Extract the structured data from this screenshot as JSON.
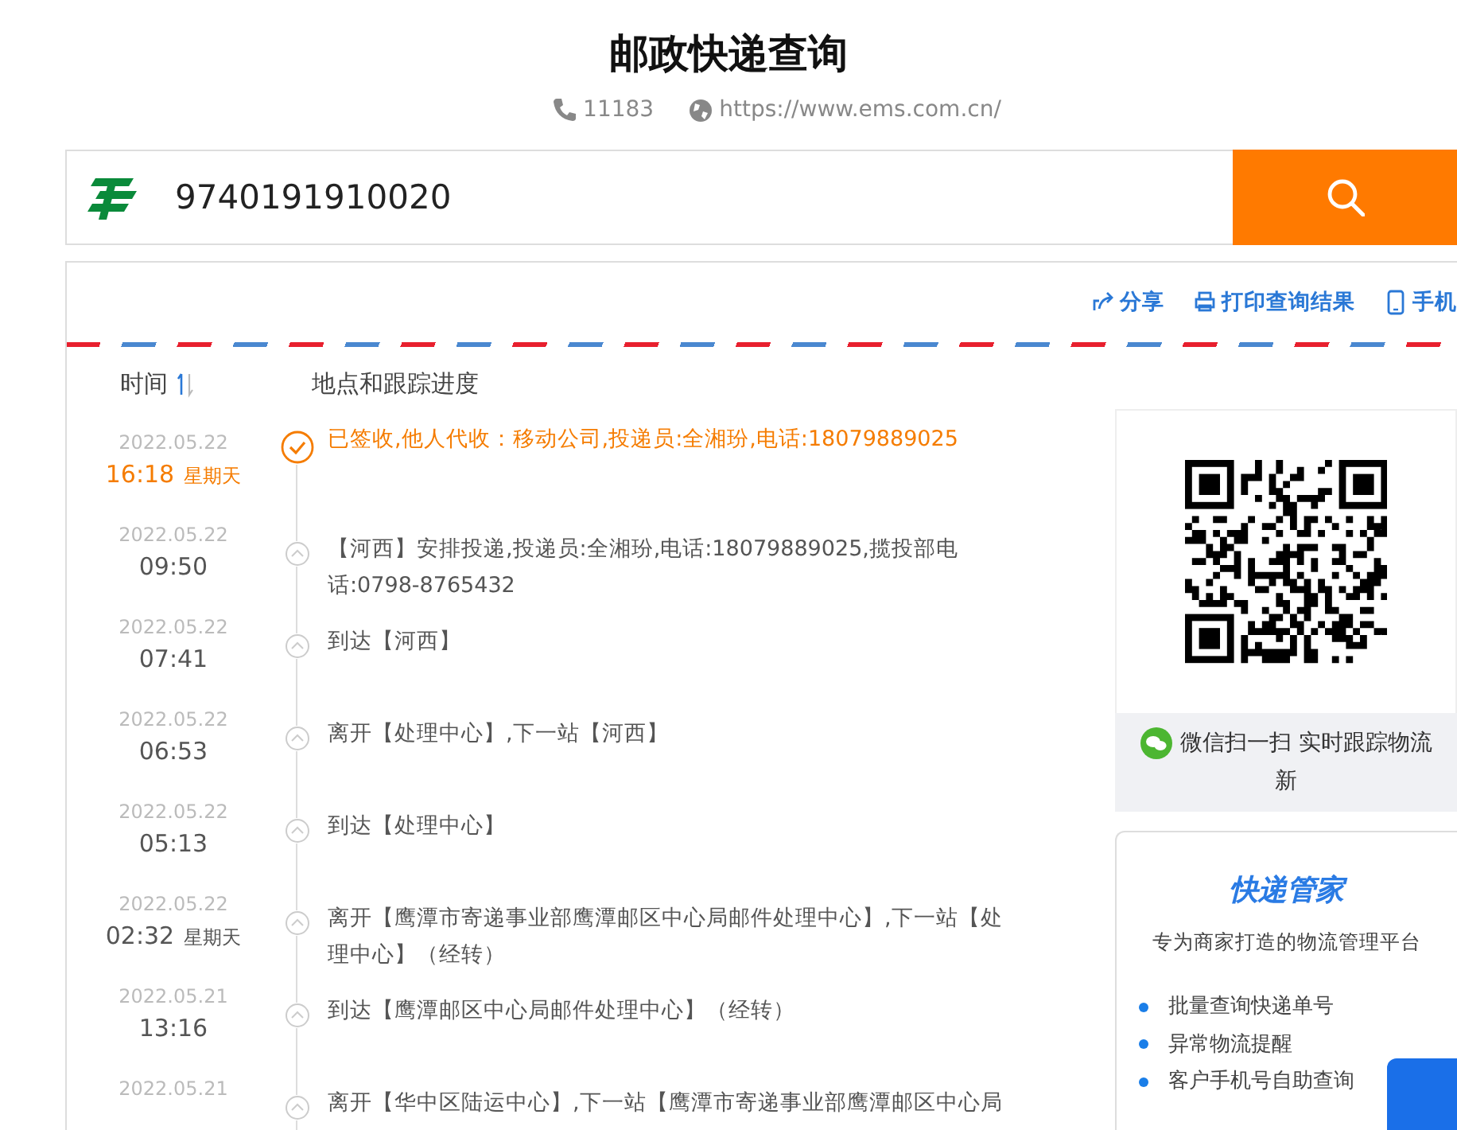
{
  "title": "邮政快递查询",
  "contact": {
    "phone": "11183",
    "website": "https://www.ems.com.cn/"
  },
  "search": {
    "value": "9740191910020"
  },
  "actions": [
    {
      "label": "分享",
      "kind": "share"
    },
    {
      "label": "打印查询结果",
      "kind": "print"
    },
    {
      "label": "手机",
      "kind": "mobile"
    }
  ],
  "columns": [
    {
      "label": "时间",
      "sortable": true
    },
    {
      "label": "地点和跟踪进度",
      "sortable": false
    }
  ],
  "events": [
    {
      "date": "2022.05.22",
      "time": "16:18",
      "weekday": "星期天",
      "text": "已签收,他人代收：移动公司,投递员:全湘玢,电话:18079889025",
      "latest": true
    },
    {
      "date": "2022.05.22",
      "time": "09:50",
      "text": "【河西】安排投递,投递员:全湘玢,电话:18079889025,揽投部电话:0798-8765432",
      "latest": false
    },
    {
      "date": "2022.05.22",
      "time": "07:41",
      "text": "到达【河西】",
      "latest": false
    },
    {
      "date": "2022.05.22",
      "time": "06:53",
      "text": "离开【处理中心】,下一站【河西】",
      "latest": false
    },
    {
      "date": "2022.05.22",
      "time": "05:13",
      "text": "到达【处理中心】",
      "latest": false
    },
    {
      "date": "2022.05.22",
      "time": "02:32",
      "weekday": "星期天",
      "text": "离开【鹰潭市寄递事业部鹰潭邮区中心局邮件处理中心】,下一站【处理中心】（经转）",
      "latest": false
    },
    {
      "date": "2022.05.21",
      "time": "13:16",
      "text": "到达【鹰潭邮区中心局邮件处理中心】（经转）",
      "latest": false
    },
    {
      "date": "2022.05.21",
      "text": "离开【华中区陆运中心】,下一站【鹰潭市寄递事业部鹰潭邮区中心局",
      "latest": false
    }
  ],
  "wechat": {
    "caption": [
      "微信扫一扫 实时跟踪物流",
      "新"
    ]
  },
  "promo": {
    "title": "快递管家",
    "subtitle": "专为商家打造的物流管理平台",
    "features": [
      "批量查询快递单号",
      "异常物流提醒",
      "客户手机号自助查询"
    ]
  }
}
